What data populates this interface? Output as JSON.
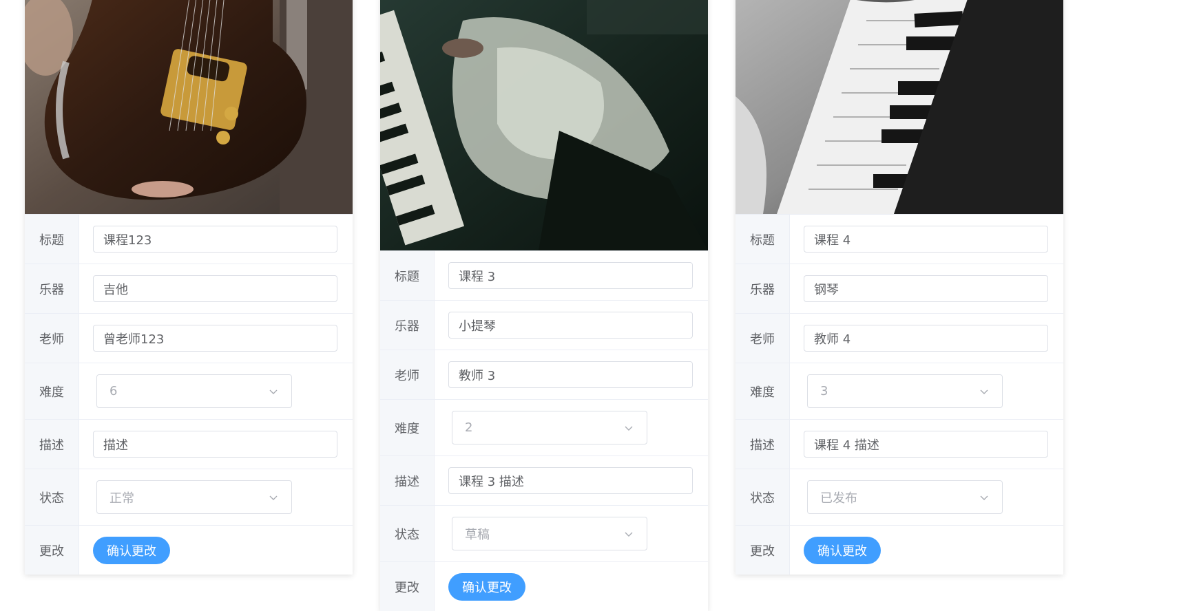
{
  "labels": {
    "title": "标题",
    "instrument": "乐器",
    "teacher": "老师",
    "difficulty": "难度",
    "description": "描述",
    "status": "状态",
    "change": "更改"
  },
  "cards": [
    {
      "photo_icon": "electric-guitar-photo",
      "title": "课程123",
      "instrument": "吉他",
      "teacher": "曾老师123",
      "difficulty": "6",
      "description": "描述",
      "status": "正常",
      "confirm_label": "确认更改"
    },
    {
      "photo_icon": "piano-player-photo",
      "title": "课程 3",
      "instrument": "小提琴",
      "teacher": "教师 3",
      "difficulty": "2",
      "description": "课程 3 描述",
      "status": "草稿",
      "confirm_label": "确认更改"
    },
    {
      "photo_icon": "piano-keys-photo",
      "title": "课程 4",
      "instrument": "钢琴",
      "teacher": "教师 4",
      "difficulty": "3",
      "description": "课程 4 描述",
      "status": "已发布",
      "confirm_label": "确认更改"
    }
  ],
  "colors": {
    "primary": "#409eff",
    "label_bg": "#f5f7fa",
    "border": "#dcdfe6"
  }
}
